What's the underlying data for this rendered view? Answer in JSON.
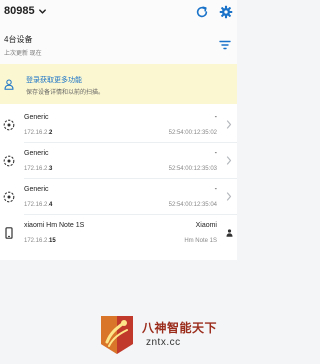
{
  "header": {
    "network_name": "80985"
  },
  "summary": {
    "device_count": "4台设备",
    "last_updated": "上次更新 现在"
  },
  "banner": {
    "title": "登录获取更多功能",
    "subtitle": "保存设备详情和以前的扫描。"
  },
  "devices": [
    {
      "name": "Generic",
      "ip_prefix": "172.16.2.",
      "ip_suffix": "2",
      "vendor": "-",
      "mac": "52:54:00:12:35:02",
      "icon": "generic-device-icon",
      "action_icon": "chevron-right-icon"
    },
    {
      "name": "Generic",
      "ip_prefix": "172.16.2.",
      "ip_suffix": "3",
      "vendor": "-",
      "mac": "52:54:00:12:35:03",
      "icon": "generic-device-icon",
      "action_icon": "chevron-right-icon"
    },
    {
      "name": "Generic",
      "ip_prefix": "172.16.2.",
      "ip_suffix": "4",
      "vendor": "-",
      "mac": "52:54:00:12:35:04",
      "icon": "generic-device-icon",
      "action_icon": "chevron-right-icon"
    },
    {
      "name": "xiaomi Hm Note 1S",
      "ip_prefix": "172.16.2.",
      "ip_suffix": "15",
      "vendor": "Xiaomi",
      "mac": "Hm Note 1S",
      "icon": "phone-icon",
      "action_icon": "person-icon"
    }
  ],
  "watermark": {
    "line1": "八神智能天下",
    "line2": "zntx.cc"
  },
  "colors": {
    "accent": "#1a73c8",
    "banner_bg": "#fbf7d0",
    "watermark_red": "#c0392b"
  }
}
